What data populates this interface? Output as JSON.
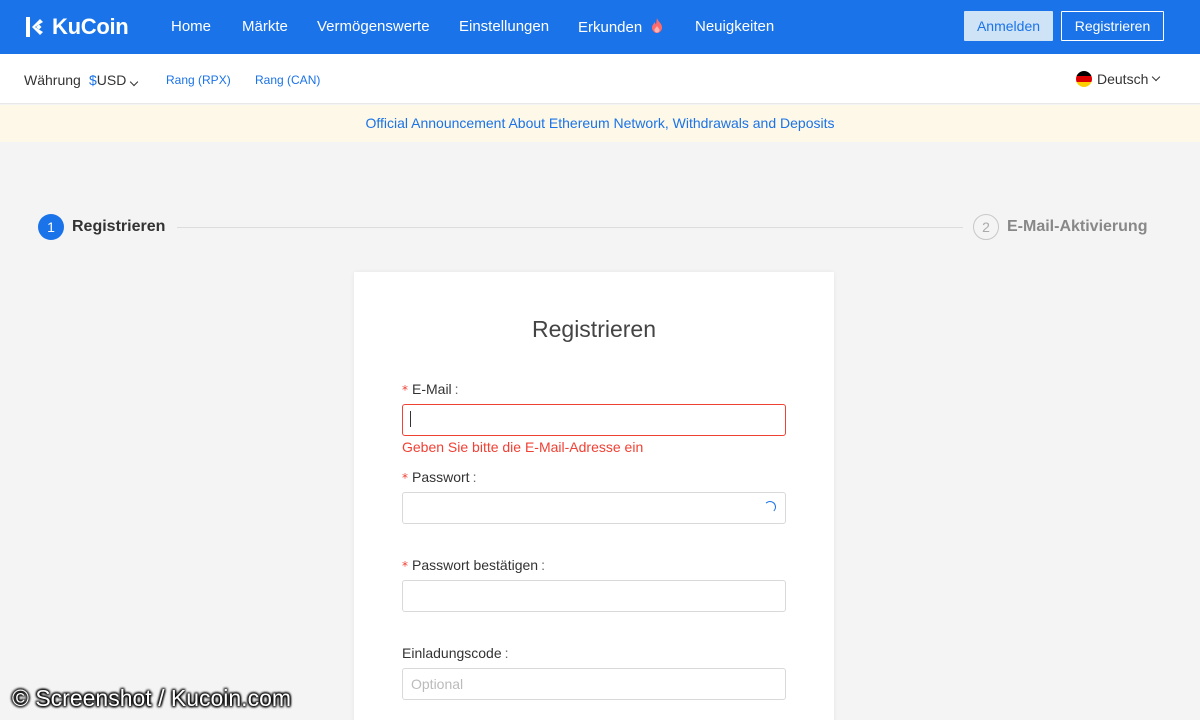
{
  "header": {
    "logo_text": "KuCoin",
    "nav": [
      "Home",
      "Märkte",
      "Vermögenswerte",
      "Einstellungen",
      "Erkunden",
      "Neuigkeiten"
    ],
    "login_label": "Anmelden",
    "register_label": "Registrieren",
    "brand_color": "#1a73e8"
  },
  "subbar": {
    "currency_label": "Währung",
    "currency_symbol": "$",
    "currency_value": "USD",
    "rank_rpx": "Rang (RPX)",
    "rank_can": "Rang (CAN)",
    "language": "Deutsch",
    "flag_icon": "germany-flag-icon"
  },
  "announcement": "Official Announcement About Ethereum Network, Withdrawals and Deposits",
  "steps": [
    {
      "number": "1",
      "label": "Registrieren",
      "active": true
    },
    {
      "number": "2",
      "label": "E-Mail-Aktivierung",
      "active": false
    }
  ],
  "form": {
    "title": "Registrieren",
    "email": {
      "required": "*",
      "label": "E-Mail",
      "colon": ":",
      "value": "",
      "error": "Geben Sie bitte die E-Mail-Adresse ein"
    },
    "password": {
      "required": "*",
      "label": "Passwort",
      "colon": ":",
      "value": ""
    },
    "password_confirm": {
      "required": "*",
      "label": "Passwort bestätigen",
      "colon": ":",
      "value": ""
    },
    "invite": {
      "label": "Einladungscode",
      "colon": ":",
      "value": "",
      "placeholder": "Optional"
    },
    "error_color": "#f04134"
  },
  "watermark": "© Screenshot / Kucoin.com"
}
